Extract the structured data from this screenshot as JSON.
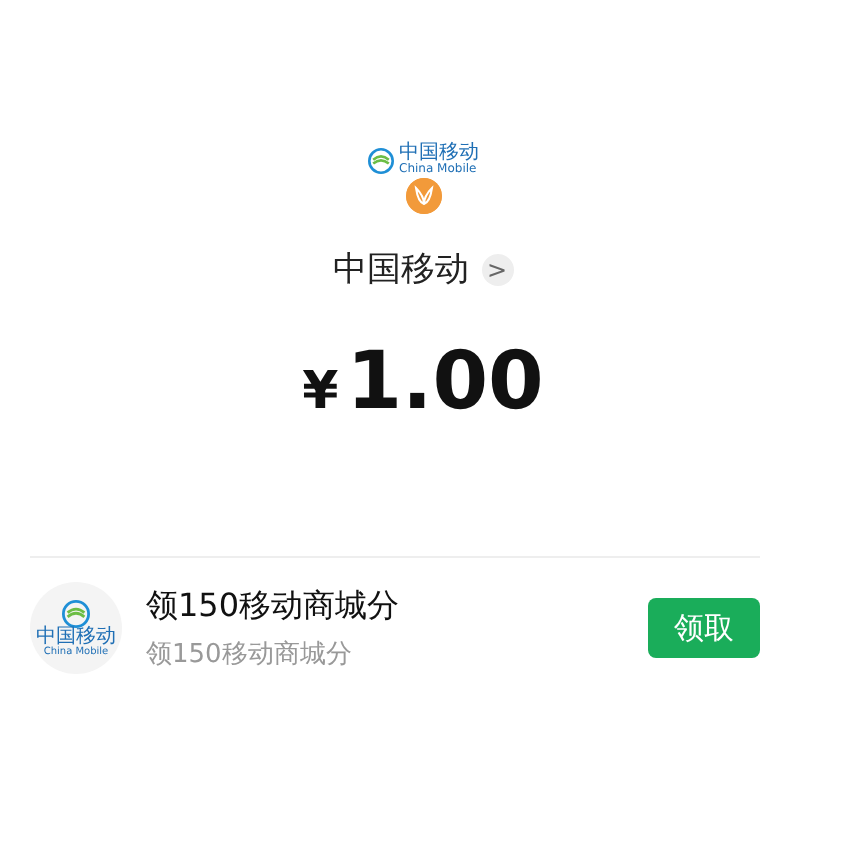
{
  "merchant": {
    "logo_cn": "中国移动",
    "logo_en": "China Mobile",
    "name": "中国移动",
    "chevron": ">"
  },
  "amount": {
    "currency": "¥",
    "value": "1.00"
  },
  "offers": [
    {
      "logo_cn": "中国移动",
      "logo_en": "China Mobile",
      "title": "领150移动商城分",
      "subtitle": "领150移动商城分",
      "button": "领取"
    }
  ]
}
